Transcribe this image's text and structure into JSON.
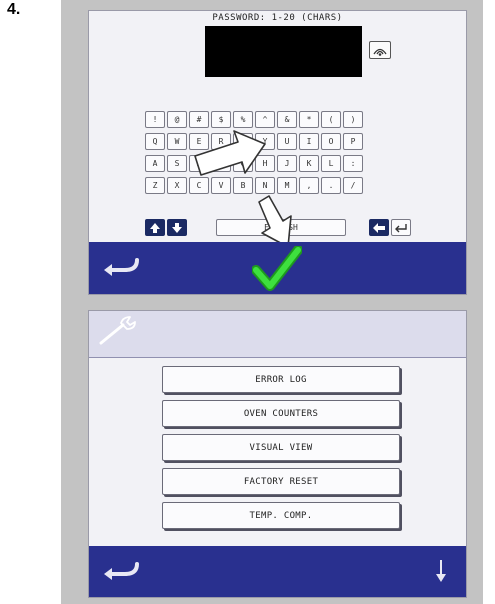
{
  "step": {
    "number": "4."
  },
  "password_screen": {
    "title": "PASSWORD: 1-20 (CHARS)",
    "keyboard_rows": [
      [
        "!",
        "@",
        "#",
        "$",
        "%",
        "^",
        "&",
        "*",
        "(",
        ")"
      ],
      [
        "Q",
        "W",
        "E",
        "R",
        "T",
        "Y",
        "U",
        "I",
        "O",
        "P"
      ],
      [
        "A",
        "S",
        "D",
        "F",
        "G",
        "H",
        "J",
        "K",
        "L",
        ":"
      ],
      [
        "Z",
        "X",
        "C",
        "V",
        "B",
        "N",
        "M",
        ",",
        ".",
        "/"
      ]
    ],
    "space_key_label": "ENGLISH"
  },
  "menu_screen": {
    "items": [
      "ERROR LOG",
      "OVEN COUNTERS",
      "VISUAL VIEW",
      "FACTORY RESET",
      "TEMP. COMP."
    ]
  },
  "colors": {
    "bar_blue": "#29308f",
    "check_green": "#2fd12f",
    "screen_bg": "#f2f2f6",
    "frame_gray": "#c3c3c3"
  }
}
